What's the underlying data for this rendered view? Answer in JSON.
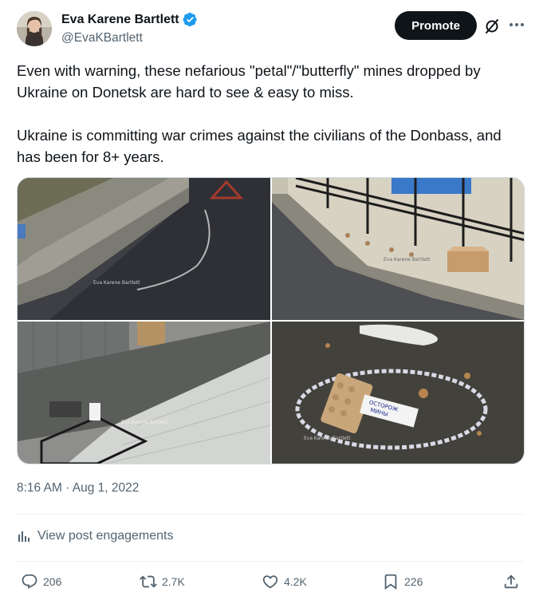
{
  "post": {
    "author": {
      "display_name": "Eva Karene Bartlett",
      "handle": "@EvaKBartlett",
      "verified": true,
      "verified_color": "#1d9bf0"
    },
    "header_actions": {
      "promote_label": "Promote",
      "grok_icon": "grok-slash-icon",
      "more_icon": "ellipsis-icon"
    },
    "text": {
      "paragraph_1": "Even with warning, these nefarious \"petal\"/\"butterfly\" mines dropped by Ukraine on Donetsk are hard to see & easy to miss.",
      "paragraph_2": "Ukraine is committing war crimes against the civilians of the Donbass, and has been for 8+ years."
    },
    "media": {
      "photos": [
        {
          "watermark": "Eva Karene Bartlett"
        },
        {
          "watermark": "Eva Karene Bartlett"
        },
        {
          "watermark": "Eva Karene Bartlett"
        },
        {
          "watermark": "Eva Karene Bartlett",
          "sign_text_line1": "ОСТОРОЖ",
          "sign_text_line2": "МИНЫ"
        }
      ]
    },
    "timestamp": "8:16 AM · Aug 1, 2022",
    "engagements_label": "View post engagements",
    "stats": {
      "replies": "206",
      "reposts": "2.7K",
      "likes": "4.2K",
      "bookmarks": "226"
    },
    "colors": {
      "text_primary": "#0f1419",
      "text_secondary": "#536471",
      "border": "#cfd9de"
    }
  }
}
